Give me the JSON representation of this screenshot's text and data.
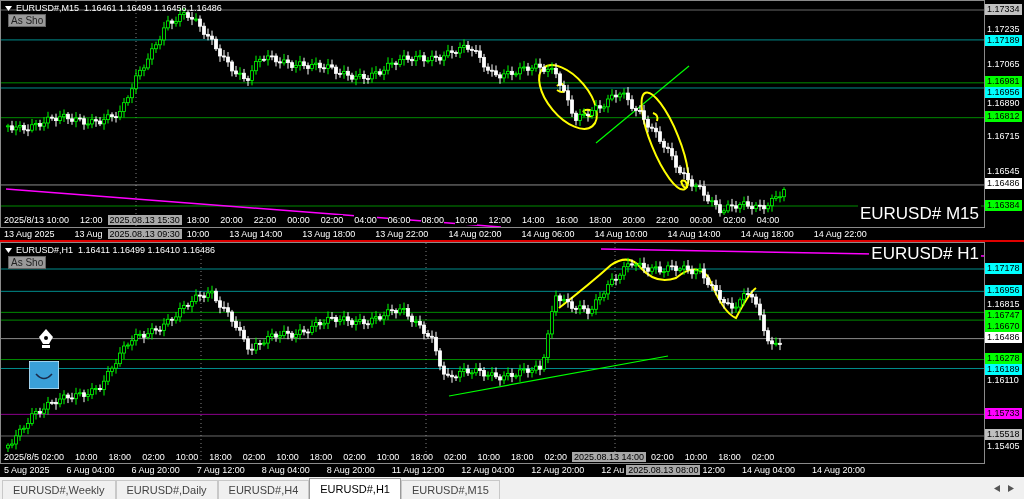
{
  "panes": [
    {
      "header": "EURUSD#,M15  1.16461 1.16499 1.16456 1.16486",
      "button": "As Sho",
      "symbol_label": "EURUSD# M15",
      "price_labels": [
        {
          "text": "1.17334",
          "kind": "tag",
          "color": "#c0c0c0"
        },
        {
          "text": "1.17235",
          "kind": "tick"
        },
        {
          "text": "1.17189",
          "kind": "tag",
          "color": "#00ffff"
        },
        {
          "text": "1.17065",
          "kind": "tick"
        },
        {
          "text": "1.16981",
          "kind": "tag",
          "color": "#00ff00"
        },
        {
          "text": "1.16956",
          "kind": "tag",
          "color": "#00ffff"
        },
        {
          "text": "1.16890",
          "kind": "tick"
        },
        {
          "text": "1.16812",
          "kind": "tag",
          "color": "#00ff00"
        },
        {
          "text": "1.16715",
          "kind": "tick"
        },
        {
          "text": "1.16545",
          "kind": "tick"
        },
        {
          "text": "1.16486",
          "kind": "tag",
          "color": "#ffffff"
        },
        {
          "text": "1.16384",
          "kind": "tag",
          "color": "#00ff00"
        }
      ],
      "inner_time_labels": [
        {
          "text": "2025/8/13 10:00",
          "kind": "tick"
        },
        {
          "text": "12:00",
          "kind": "tick"
        },
        {
          "text": "2025.08.13 15:30",
          "kind": "cursor"
        },
        {
          "text": "18:00",
          "kind": "tick"
        },
        {
          "text": "20:00",
          "kind": "tick"
        },
        {
          "text": "22:00",
          "kind": "tick"
        },
        {
          "text": "00:00",
          "kind": "tick"
        },
        {
          "text": "02:00",
          "kind": "tick"
        },
        {
          "text": "04:00",
          "kind": "tick"
        },
        {
          "text": "06:00",
          "kind": "tick"
        },
        {
          "text": "08:00",
          "kind": "tick"
        },
        {
          "text": "10:00",
          "kind": "tick"
        },
        {
          "text": "12:00",
          "kind": "tick"
        },
        {
          "text": "14:00",
          "kind": "tick"
        },
        {
          "text": "16:00",
          "kind": "tick"
        },
        {
          "text": "18:00",
          "kind": "tick"
        },
        {
          "text": "20:00",
          "kind": "tick"
        },
        {
          "text": "22:00",
          "kind": "tick"
        },
        {
          "text": "00:00",
          "kind": "tick"
        },
        {
          "text": "02:00",
          "kind": "tick"
        },
        {
          "text": "04:00",
          "kind": "tick"
        }
      ],
      "time_labels": [
        {
          "text": "13 Aug 2025",
          "kind": "tick"
        },
        {
          "text": "13 Aug",
          "kind": "tick"
        },
        {
          "text": "2025.08.13 09:30",
          "kind": "cursor"
        },
        {
          "text": "10:00",
          "kind": "tick"
        },
        {
          "text": "13 Aug 14:00",
          "kind": "tick"
        },
        {
          "text": "13 Aug 18:00",
          "kind": "tick"
        },
        {
          "text": "13 Aug 22:00",
          "kind": "tick"
        },
        {
          "text": "14 Aug 02:00",
          "kind": "tick"
        },
        {
          "text": "14 Aug 06:00",
          "kind": "tick"
        },
        {
          "text": "14 Aug 10:00",
          "kind": "tick"
        },
        {
          "text": "14 Aug 14:00",
          "kind": "tick"
        },
        {
          "text": "14 Aug 18:00",
          "kind": "tick"
        },
        {
          "text": "14 Aug 22:00",
          "kind": "tick"
        }
      ]
    },
    {
      "header": "EURUSD#,H1  1.16411 1.16499 1.16410 1.16486",
      "button": "As Sho",
      "symbol_label": "EURUSD# H1",
      "price_labels": [
        {
          "text": "1.17178",
          "kind": "tag",
          "color": "#00ffff"
        },
        {
          "text": "1.16956",
          "kind": "tag",
          "color": "#00ffff"
        },
        {
          "text": "1.16815",
          "kind": "tick"
        },
        {
          "text": "1.16747",
          "kind": "tag",
          "color": "#00ff00"
        },
        {
          "text": "1.16670",
          "kind": "tag",
          "color": "#00ff00"
        },
        {
          "text": "1.16486",
          "kind": "tag",
          "color": "#ffffff"
        },
        {
          "text": "1.16278",
          "kind": "tag",
          "color": "#00ff00"
        },
        {
          "text": "1.16189",
          "kind": "tag",
          "color": "#00ffff"
        },
        {
          "text": "1.16110",
          "kind": "tick"
        },
        {
          "text": "1.15733",
          "kind": "tag",
          "color": "#ff00ff"
        },
        {
          "text": "1.15518",
          "kind": "tag",
          "color": "#c0c0c0"
        },
        {
          "text": "1.15405",
          "kind": "tick"
        }
      ],
      "inner_time_labels": [
        {
          "text": "2025/8/5 02:00",
          "kind": "tick"
        },
        {
          "text": "10:00",
          "kind": "tick"
        },
        {
          "text": "18:00",
          "kind": "tick"
        },
        {
          "text": "02:00",
          "kind": "tick"
        },
        {
          "text": "10:00",
          "kind": "tick"
        },
        {
          "text": "18:00",
          "kind": "tick"
        },
        {
          "text": "02:00",
          "kind": "tick"
        },
        {
          "text": "10:00",
          "kind": "tick"
        },
        {
          "text": "18:00",
          "kind": "tick"
        },
        {
          "text": "02:00",
          "kind": "tick"
        },
        {
          "text": "10:00",
          "kind": "tick"
        },
        {
          "text": "18:00",
          "kind": "tick"
        },
        {
          "text": "02:00",
          "kind": "tick"
        },
        {
          "text": "10:00",
          "kind": "tick"
        },
        {
          "text": "18:00",
          "kind": "tick"
        },
        {
          "text": "02:00",
          "kind": "tick"
        },
        {
          "text": "2025.08.13 14:00",
          "kind": "cursor"
        },
        {
          "text": "02:00",
          "kind": "tick"
        },
        {
          "text": "10:00",
          "kind": "tick"
        },
        {
          "text": "18:00",
          "kind": "tick"
        },
        {
          "text": "02:00",
          "kind": "tick"
        }
      ],
      "time_labels": [
        {
          "text": "5 Aug 2025",
          "kind": "tick"
        },
        {
          "text": "6 Aug 04:00",
          "kind": "tick"
        },
        {
          "text": "6 Aug 20:00",
          "kind": "tick"
        },
        {
          "text": "7 Aug 12:00",
          "kind": "tick"
        },
        {
          "text": "8 Aug 04:00",
          "kind": "tick"
        },
        {
          "text": "8 Aug 20:00",
          "kind": "tick"
        },
        {
          "text": "11 Aug 12:00",
          "kind": "tick"
        },
        {
          "text": "12 Aug 04:00",
          "kind": "tick"
        },
        {
          "text": "12 Aug 20:00",
          "kind": "tick"
        },
        {
          "text": "12 Au",
          "kind": "tick"
        },
        {
          "text": "2025.08.13 08:00",
          "kind": "cursor"
        },
        {
          "text": "12:00",
          "kind": "tick"
        },
        {
          "text": "14 Aug 04:00",
          "kind": "tick"
        },
        {
          "text": "14 Aug 20:00",
          "kind": "tick"
        }
      ]
    }
  ],
  "tabs": [
    {
      "label": "EURUSD#,Weekly",
      "selected": false
    },
    {
      "label": "EURUSD#,Daily",
      "selected": false
    },
    {
      "label": "EURUSD#,H4",
      "selected": false
    },
    {
      "label": "EURUSD#,H1",
      "selected": true
    },
    {
      "label": "EURUSD#,M15",
      "selected": false
    }
  ]
}
